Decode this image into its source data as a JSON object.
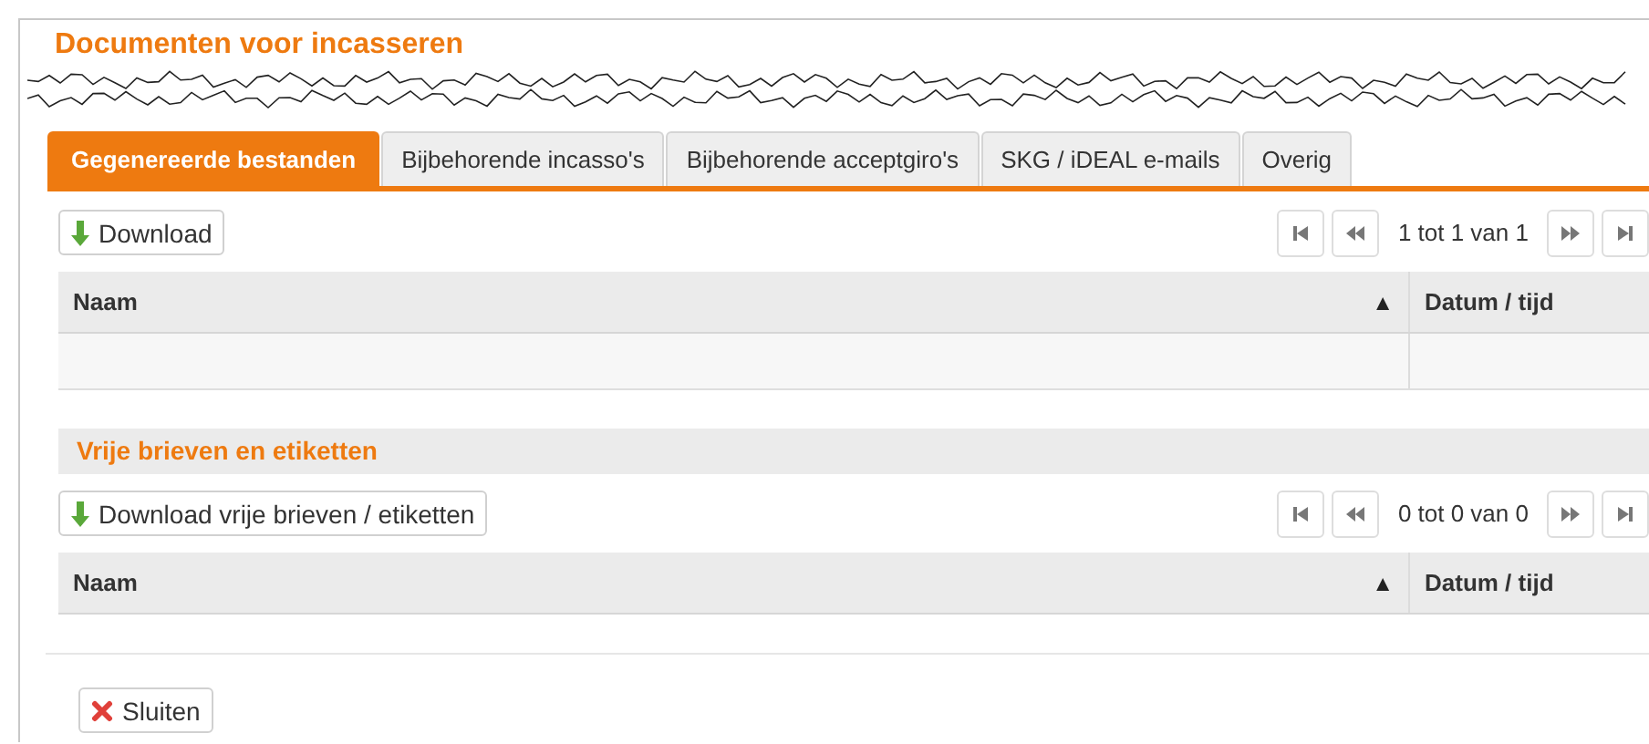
{
  "title": "Documenten voor incasseren",
  "tabs": [
    {
      "label": "Gegenereerde bestanden",
      "selected": true
    },
    {
      "label": "Bijbehorende incasso's",
      "selected": false
    },
    {
      "label": "Bijbehorende acceptgiro's",
      "selected": false
    },
    {
      "label": "SKG / iDEAL e-mails",
      "selected": false
    },
    {
      "label": "Overig",
      "selected": false
    }
  ],
  "sections": [
    {
      "download_button": "Download",
      "pager": "1 tot 1 van 1",
      "columns": [
        {
          "label": "Naam",
          "sort": "▲"
        },
        {
          "label": "Datum / tijd"
        }
      ],
      "empty_row": true
    },
    {
      "heading": "Vrije brieven en etiketten",
      "download_button": "Download vrije brieven / etiketten",
      "pager": "0 tot 0 van 0",
      "columns": [
        {
          "label": "Naam",
          "sort": "▲"
        },
        {
          "label": "Datum / tijd"
        }
      ]
    }
  ],
  "close_button": "Sluiten"
}
